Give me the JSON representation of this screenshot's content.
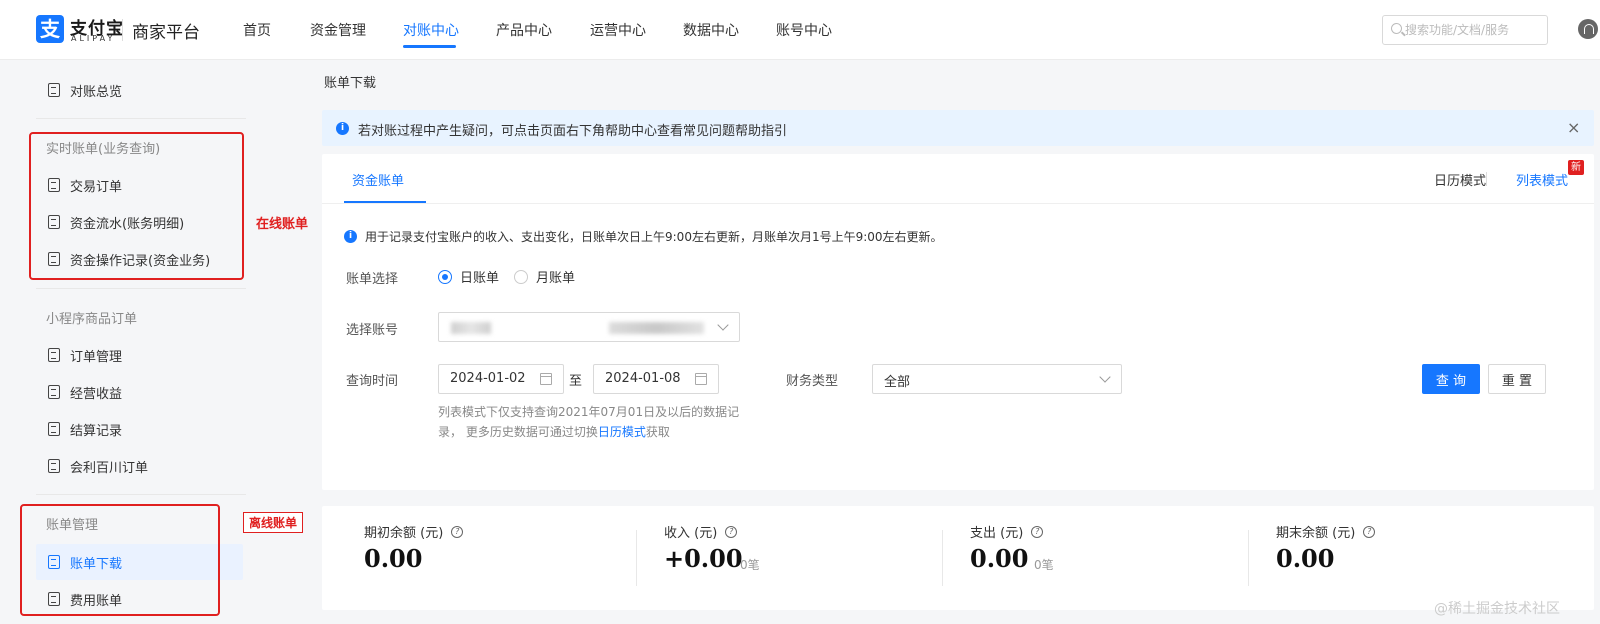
{
  "brand": {
    "logo_glyph": "支",
    "name": "支付宝",
    "sub": "ALIPAY",
    "platform": "商家平台"
  },
  "nav": [
    {
      "label": "首页"
    },
    {
      "label": "资金管理"
    },
    {
      "label": "对账中心"
    },
    {
      "label": "产品中心"
    },
    {
      "label": "运营中心"
    },
    {
      "label": "数据中心"
    },
    {
      "label": "账号中心"
    }
  ],
  "search": {
    "placeholder": "搜索功能/文档/服务"
  },
  "sidebar": {
    "overview": "对账总览",
    "group_realtime": "实时账单(业务查询)",
    "realtime_items": [
      "交易订单",
      "资金流水(账务明细)",
      "资金操作记录(资金业务)"
    ],
    "group_miniapp": "小程序商品订单",
    "miniapp_items": [
      "订单管理",
      "经营收益",
      "结算记录",
      "会利百川订单"
    ],
    "group_bill": "账单管理",
    "bill_items": [
      "账单下载",
      "费用账单"
    ]
  },
  "annotations": {
    "online": "在线账单",
    "offline": "离线账单"
  },
  "page_title": "账单下载",
  "alert": {
    "icon": "i",
    "text": "若对账过程中产生疑问，可点击页面右下角帮助中心查看常见问题帮助指引",
    "close": "×"
  },
  "card": {
    "tab": "资金账单",
    "mode_calendar": "日历模式",
    "mode_list": "列表模式",
    "new_badge": "新",
    "description": "用于记录支付宝账户的收入、支出变化，日账单次日上午9:00左右更新，月账单次月1号上午9:00左右更新。",
    "bill_select_label": "账单选择",
    "radio_daily": "日账单",
    "radio_monthly": "月账单",
    "account_label": "选择账号",
    "time_label": "查询时间",
    "date_from": "2024-01-02",
    "date_to_word": "至",
    "date_to": "2024-01-08",
    "finance_type_label": "财务类型",
    "finance_type_value": "全部",
    "query_button": "查 询",
    "reset_button": "重 置",
    "hint_prefix": "列表模式下仅支持查询2021年07月01日及以后的数据记录， 更多历史数据可通过切换",
    "hint_link": "日历模式",
    "hint_suffix": "获取"
  },
  "stats": [
    {
      "label": "期初余额 (元)",
      "value": "0.00",
      "count": ""
    },
    {
      "label": "收入 (元)",
      "value": "+0.00",
      "count": "0笔"
    },
    {
      "label": "支出 (元)",
      "value": "0.00",
      "count": "0笔"
    },
    {
      "label": "期末余额 (元)",
      "value": "0.00",
      "count": ""
    }
  ],
  "watermark": "@稀土掘金技术社区",
  "colors": {
    "accent": "#1677ff",
    "annotation": "#e02020",
    "alert_bg": "#e8f3ff"
  }
}
